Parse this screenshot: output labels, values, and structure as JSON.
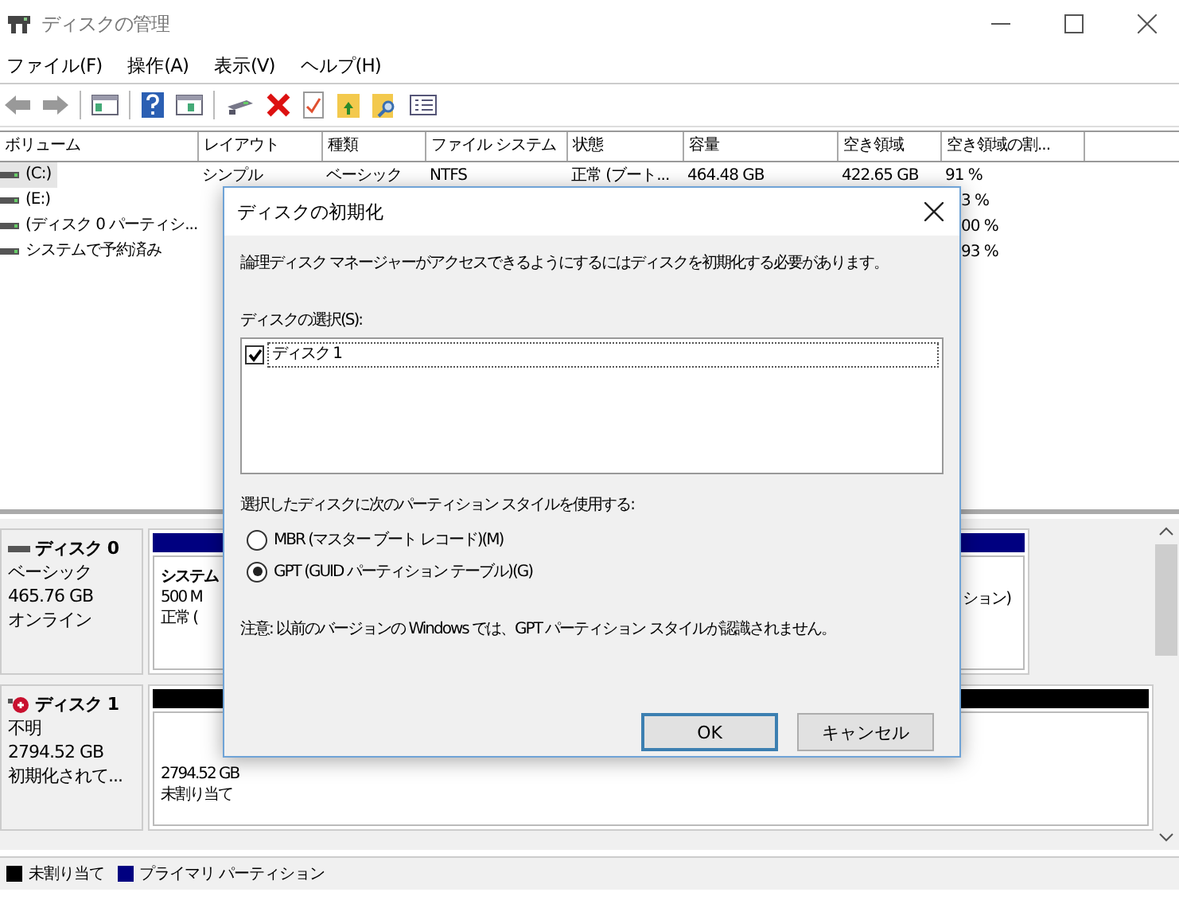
{
  "window": {
    "title": "ディスクの管理"
  },
  "menu": [
    "ファイル(F)",
    "操作(A)",
    "表示(V)",
    "ヘルプ(H)"
  ],
  "volume_table": {
    "columns": [
      "ボリューム",
      "レイアウト",
      "種類",
      "ファイル システム",
      "状態",
      "容量",
      "空き領域",
      "空き領域の割..."
    ],
    "rows": [
      {
        "volume": "(C:)",
        "layout": "シンプル",
        "type": "ベーシック",
        "file_system": "NTFS",
        "status": "正常 (ブート...",
        "capacity": "464.48 GB",
        "free": "422.65 GB",
        "free_percent": "91 %",
        "selected": true
      },
      {
        "volume": "(E:)",
        "free_percent": "3 %",
        "selected": false
      },
      {
        "volume": "(ディスク 0 パーティシ...",
        "free_percent": "00 %",
        "selected": false
      },
      {
        "volume": "システムで予約済み",
        "free_percent": "93 %",
        "selected": false
      }
    ]
  },
  "disks": [
    {
      "name": "ディスク 0",
      "kind": "online",
      "lines": [
        "ベーシック",
        "465.76 GB",
        "オンライン"
      ],
      "color": "#000080",
      "partition": {
        "kind": "volume",
        "lines": [
          "システム",
          "500 M",
          "正常 ("
        ],
        "tail": "ション)"
      }
    },
    {
      "name": "ディスク 1",
      "kind": "error",
      "lines": [
        "不明",
        "2794.52 GB",
        "初期化されて..."
      ],
      "color": "#000000",
      "partition": {
        "kind": "unallocated",
        "lines": [
          "2794.52 GB",
          "未割り当て"
        ]
      }
    }
  ],
  "legend": [
    {
      "label": "未割り当て",
      "color": "#000000"
    },
    {
      "label": "プライマリ パーティション",
      "color": "#000080"
    }
  ],
  "dialog": {
    "title": "ディスクの初期化",
    "message": "論理ディスク マネージャーがアクセスできるようにするにはディスクを初期化する必要があります。",
    "list_label": "ディスクの選択(S):",
    "disks": [
      {
        "label": "ディスク 1",
        "checked": true
      }
    ],
    "style_label": "選択したディスクに次のパーティション スタイルを使用する:",
    "styles": [
      {
        "label": "MBR (マスター ブート レコード)(M)",
        "selected": false
      },
      {
        "label": "GPT (GUID パーティション テーブル)(G)",
        "selected": true
      }
    ],
    "note": "注意: 以前のバージョンの Windows では、GPT パーティション スタイルが認識されません。",
    "buttons": [
      {
        "label": "OK",
        "default": true
      },
      {
        "label": "キャンセル",
        "default": false
      }
    ]
  }
}
